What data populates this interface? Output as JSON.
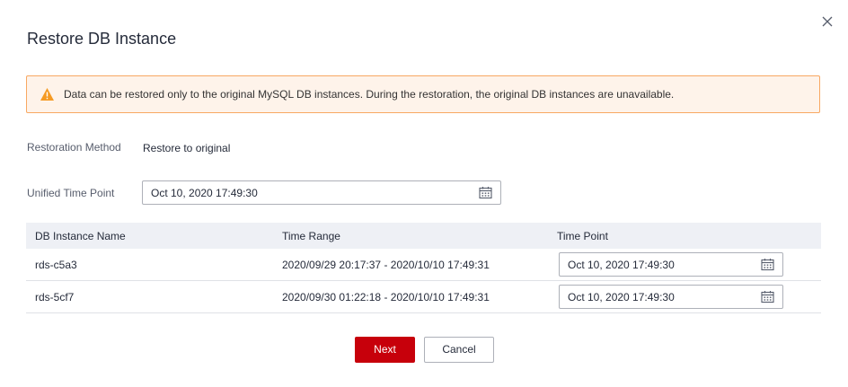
{
  "dialog": {
    "title": "Restore DB Instance",
    "close_icon": "close-icon"
  },
  "alert": {
    "icon": "warning-icon",
    "message": "Data can be restored only to the original MySQL DB instances. During the restoration, the original DB instances are unavailable.",
    "accent_color": "#f8a862",
    "icon_color": "#f59a23"
  },
  "form": {
    "method_label": "Restoration Method",
    "method_value": "Restore to original",
    "unified_label": "Unified Time Point",
    "unified_value": "Oct 10, 2020 17:49:30",
    "calendar_icon": "calendar-icon"
  },
  "table": {
    "headers": [
      "DB Instance Name",
      "Time Range",
      "Time Point"
    ],
    "rows": [
      {
        "name": "rds-c5a3",
        "range": "2020/09/29 20:17:37 - 2020/10/10 17:49:31",
        "point": "Oct 10, 2020 17:49:30"
      },
      {
        "name": "rds-5cf7",
        "range": "2020/09/30 01:22:18 - 2020/10/10 17:49:31",
        "point": "Oct 10, 2020 17:49:30"
      }
    ]
  },
  "buttons": {
    "next": "Next",
    "cancel": "Cancel",
    "primary_color": "#c7000b"
  }
}
